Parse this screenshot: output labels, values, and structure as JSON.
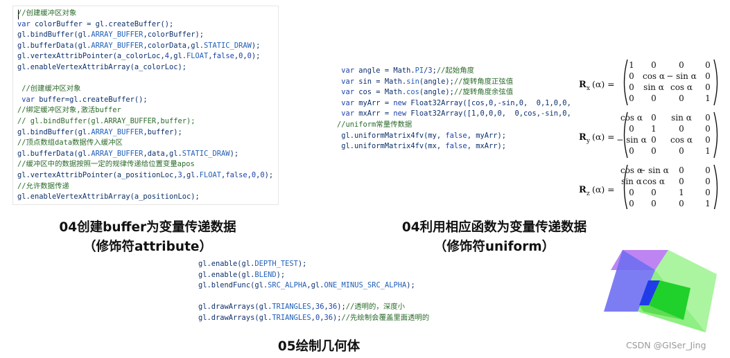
{
  "snippet1": {
    "lines": [
      [
        {
          "t": "//创建缓冲区对象",
          "c": "cm"
        }
      ],
      [
        {
          "t": "var ",
          "c": "kw"
        },
        {
          "t": "colorBuffer = gl.createBuffer();",
          "c": "plain"
        }
      ],
      [
        {
          "t": "gl.bindBuffer(gl.",
          "c": "plain"
        },
        {
          "t": "ARRAY_BUFFER",
          "c": "cn"
        },
        {
          "t": ",colorBuffer);",
          "c": "plain"
        }
      ],
      [
        {
          "t": "gl.bufferData(gl.",
          "c": "plain"
        },
        {
          "t": "ARRAY_BUFFER",
          "c": "cn"
        },
        {
          "t": ",colorData,gl.",
          "c": "plain"
        },
        {
          "t": "STATIC_DRAW",
          "c": "cn"
        },
        {
          "t": ");",
          "c": "plain"
        }
      ],
      [
        {
          "t": "gl.vertexAttribPointer(a_colorLoc,",
          "c": "plain"
        },
        {
          "t": "4",
          "c": "nm"
        },
        {
          "t": ",gl.",
          "c": "plain"
        },
        {
          "t": "FLOAT",
          "c": "cn"
        },
        {
          "t": ",",
          "c": "plain"
        },
        {
          "t": "false",
          "c": "kw"
        },
        {
          "t": ",",
          "c": "plain"
        },
        {
          "t": "0",
          "c": "nm"
        },
        {
          "t": ",",
          "c": "plain"
        },
        {
          "t": "0",
          "c": "nm"
        },
        {
          "t": ");",
          "c": "plain"
        }
      ],
      [
        {
          "t": "gl.enableVertexAttribArray(a_colorLoc);",
          "c": "plain"
        }
      ],
      [],
      [
        {
          "t": " //创建缓冲区对象",
          "c": "cm"
        }
      ],
      [
        {
          "t": " var ",
          "c": "kw"
        },
        {
          "t": "buffer=gl.createBuffer();",
          "c": "plain"
        }
      ],
      [
        {
          "t": "//绑定缓冲区对象,激活buffer",
          "c": "cm"
        }
      ],
      [
        {
          "t": "// gl.bindBuffer(gl.ARRAY_BUFFER,buffer);",
          "c": "cm"
        }
      ],
      [
        {
          "t": "gl.bindBuffer(gl.",
          "c": "plain"
        },
        {
          "t": "ARRAY_BUFFER",
          "c": "cn"
        },
        {
          "t": ",buffer);",
          "c": "plain"
        }
      ],
      [
        {
          "t": "//顶点数组data数据传入缓冲区",
          "c": "cm"
        }
      ],
      [
        {
          "t": "gl.bufferData(gl.",
          "c": "plain"
        },
        {
          "t": "ARRAY_BUFFER",
          "c": "cn"
        },
        {
          "t": ",data,gl.",
          "c": "plain"
        },
        {
          "t": "STATIC_DRAW",
          "c": "cn"
        },
        {
          "t": ");",
          "c": "plain"
        }
      ],
      [
        {
          "t": "//缓冲区中的数据按照一定的规律传递给位置变量apos",
          "c": "cm"
        }
      ],
      [
        {
          "t": "gl.vertexAttribPointer(a_positionLoc,",
          "c": "plain"
        },
        {
          "t": "3",
          "c": "nm"
        },
        {
          "t": ",gl.",
          "c": "plain"
        },
        {
          "t": "FLOAT",
          "c": "cn"
        },
        {
          "t": ",",
          "c": "plain"
        },
        {
          "t": "false",
          "c": "kw"
        },
        {
          "t": ",",
          "c": "plain"
        },
        {
          "t": "0",
          "c": "nm"
        },
        {
          "t": ",",
          "c": "plain"
        },
        {
          "t": "0",
          "c": "nm"
        },
        {
          "t": ");",
          "c": "plain"
        }
      ],
      [
        {
          "t": "//允许数据传递",
          "c": "cm"
        }
      ],
      [
        {
          "t": "gl.enableVertexAttribArray(a_positionLoc);",
          "c": "plain"
        }
      ]
    ]
  },
  "snippet2": {
    "lines": [
      [
        {
          "t": " var ",
          "c": "kw"
        },
        {
          "t": "angle = Math.",
          "c": "plain"
        },
        {
          "t": "PI",
          "c": "cn"
        },
        {
          "t": "/",
          "c": "plain"
        },
        {
          "t": "3",
          "c": "nm"
        },
        {
          "t": ";",
          "c": "plain"
        },
        {
          "t": "//起始角度",
          "c": "cm"
        }
      ],
      [
        {
          "t": " var ",
          "c": "kw"
        },
        {
          "t": "sin = Math.",
          "c": "plain"
        },
        {
          "t": "sin",
          "c": "cn"
        },
        {
          "t": "(angle);",
          "c": "plain"
        },
        {
          "t": "//旋转角度正弦值",
          "c": "cm"
        }
      ],
      [
        {
          "t": " var ",
          "c": "kw"
        },
        {
          "t": "cos = Math.",
          "c": "plain"
        },
        {
          "t": "cos",
          "c": "cn"
        },
        {
          "t": "(angle);",
          "c": "plain"
        },
        {
          "t": "//旋转角度余弦值",
          "c": "cm"
        }
      ],
      [
        {
          "t": " var ",
          "c": "kw"
        },
        {
          "t": "myArr = ",
          "c": "plain"
        },
        {
          "t": "new ",
          "c": "kw"
        },
        {
          "t": "Float32Array([cos,0,-sin,0,  0,1,0,0,",
          "c": "plain"
        }
      ],
      [
        {
          "t": " var ",
          "c": "kw"
        },
        {
          "t": "mxArr = ",
          "c": "plain"
        },
        {
          "t": "new ",
          "c": "kw"
        },
        {
          "t": "Float32Array([1,0,0,0,  0,cos,-sin,0,",
          "c": "plain"
        }
      ],
      [
        {
          "t": "//uniform常量传数据",
          "c": "cm"
        }
      ],
      [
        {
          "t": " gl.uniformMatrix4fv(my, ",
          "c": "plain"
        },
        {
          "t": "false",
          "c": "kw"
        },
        {
          "t": ", myArr);",
          "c": "plain"
        }
      ],
      [
        {
          "t": " gl.uniformMatrix4fv(mx, ",
          "c": "plain"
        },
        {
          "t": "false",
          "c": "kw"
        },
        {
          "t": ", mxArr);",
          "c": "plain"
        }
      ]
    ]
  },
  "snippet3": {
    "lines": [
      [
        {
          "t": "gl.enable(gl.",
          "c": "plain"
        },
        {
          "t": "DEPTH_TEST",
          "c": "cn"
        },
        {
          "t": ");",
          "c": "plain"
        }
      ],
      [
        {
          "t": "gl.enable(gl.",
          "c": "plain"
        },
        {
          "t": "BLEND",
          "c": "cn"
        },
        {
          "t": ");",
          "c": "plain"
        }
      ],
      [
        {
          "t": "gl.blendFunc(gl.",
          "c": "plain"
        },
        {
          "t": "SRC_ALPHA",
          "c": "cn"
        },
        {
          "t": ",gl.",
          "c": "plain"
        },
        {
          "t": "ONE_MINUS_SRC_ALPHA",
          "c": "cn"
        },
        {
          "t": ");",
          "c": "plain"
        }
      ],
      [],
      [
        {
          "t": "gl.drawArrays(gl.",
          "c": "plain"
        },
        {
          "t": "TRIANGLES",
          "c": "cn"
        },
        {
          "t": ",",
          "c": "plain"
        },
        {
          "t": "36",
          "c": "nm"
        },
        {
          "t": ",",
          "c": "plain"
        },
        {
          "t": "36",
          "c": "nm"
        },
        {
          "t": ");",
          "c": "plain"
        },
        {
          "t": "//透明的，深度小",
          "c": "cm"
        }
      ],
      [
        {
          "t": "gl.drawArrays(gl.",
          "c": "plain"
        },
        {
          "t": "TRIANGLES",
          "c": "cn"
        },
        {
          "t": ",",
          "c": "plain"
        },
        {
          "t": "0",
          "c": "nm"
        },
        {
          "t": ",",
          "c": "plain"
        },
        {
          "t": "36",
          "c": "nm"
        },
        {
          "t": ");",
          "c": "plain"
        },
        {
          "t": "//先绘制会覆盖里面透明的",
          "c": "cm"
        }
      ]
    ]
  },
  "captions": {
    "c1_line1": "04创建buffer为变量传递数据",
    "c1_line2": "（修饰符attribute）",
    "c2_line1": "04利用相应函数为变量传递数据",
    "c2_line2": "（修饰符uniform）",
    "c3": "05绘制几何体"
  },
  "matrices": {
    "rx": {
      "label": "R",
      "sub": "x",
      "arg": "(α) =",
      "rows": [
        [
          "1",
          "0",
          "0",
          "0"
        ],
        [
          "0",
          "cos α",
          "− sin α",
          "0"
        ],
        [
          "0",
          "sin α",
          "cos α",
          "0"
        ],
        [
          "0",
          "0",
          "0",
          "1"
        ]
      ]
    },
    "ry": {
      "label": "R",
      "sub": "y",
      "arg": "(α) =",
      "rows": [
        [
          "cos α",
          "0",
          "sin α",
          "0"
        ],
        [
          "0",
          "1",
          "0",
          "0"
        ],
        [
          "− sin α",
          "0",
          "cos α",
          "0"
        ],
        [
          "0",
          "0",
          "0",
          "1"
        ]
      ]
    },
    "rz": {
      "label": "R",
      "sub": "z",
      "arg": "(α) =",
      "rows": [
        [
          "cos α",
          "− sin α",
          "0",
          "0"
        ],
        [
          "sin α",
          "cos α",
          "0",
          "0"
        ],
        [
          "0",
          "0",
          "1",
          "0"
        ],
        [
          "0",
          "0",
          "0",
          "1"
        ]
      ]
    }
  },
  "watermark": "CSDN @GISer_Jing",
  "colors": {
    "comment": "#2a6a2a",
    "keyword": "#1a3fa8",
    "constant": "#1f5fb8",
    "text": "#0b2f6b",
    "cube_blue": "#6f6ff2",
    "cube_green": "#58e94d",
    "cube_purple": "#b26ff0"
  }
}
